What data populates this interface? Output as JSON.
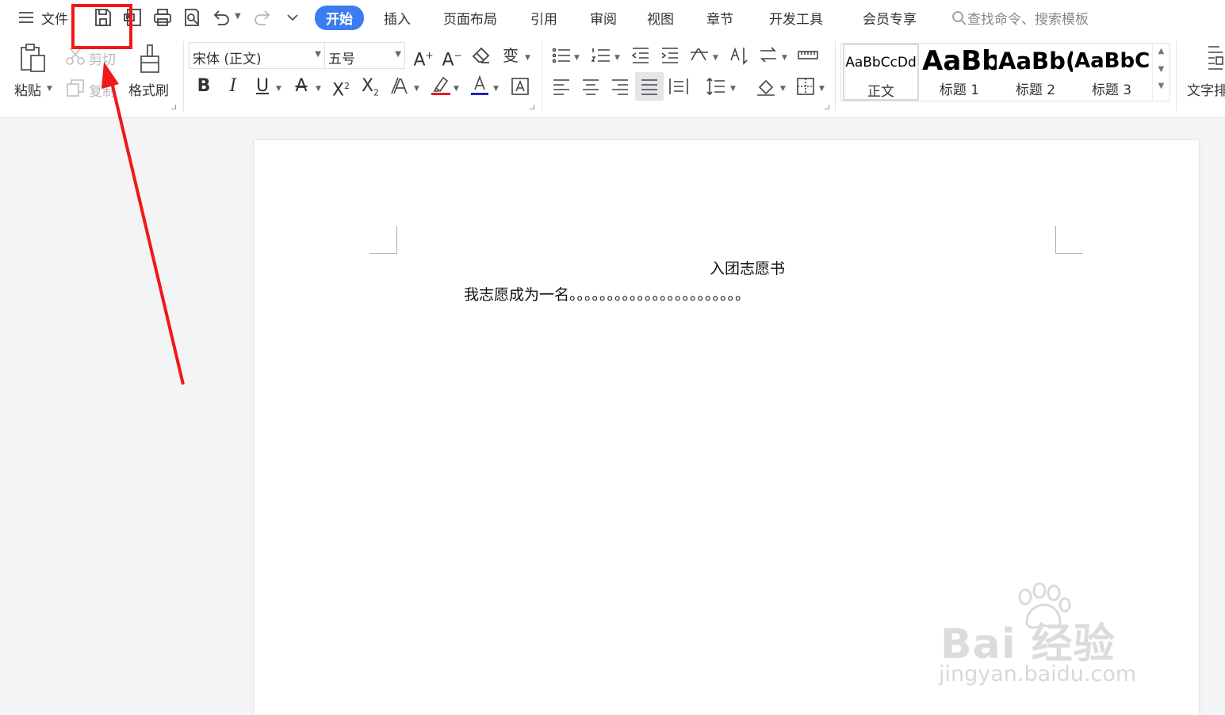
{
  "menubar": {
    "file_label": "文件",
    "tabs": [
      {
        "label": "开始",
        "active": true
      },
      {
        "label": "插入"
      },
      {
        "label": "页面布局"
      },
      {
        "label": "引用"
      },
      {
        "label": "审阅"
      },
      {
        "label": "视图"
      },
      {
        "label": "章节"
      },
      {
        "label": "开发工具"
      },
      {
        "label": "会员专享"
      }
    ],
    "search_placeholder": "查找命令、搜索模板",
    "quick_access_icons": [
      "save-icon",
      "export-pdf-icon",
      "print-icon",
      "print-preview-icon",
      "undo-icon",
      "redo-icon",
      "customize-icon"
    ]
  },
  "ribbon": {
    "clipboard": {
      "paste_label": "粘贴",
      "cut_label": "剪切",
      "copy_label": "复制",
      "format_painter_label": "格式刷"
    },
    "font": {
      "font_name": "宋体 (正文)",
      "font_size": "五号",
      "highlight_color": "#e8191e",
      "font_color": "#1f24c8"
    },
    "styles": [
      {
        "sample": "AaBbCcDd",
        "name": "正文",
        "selected": true
      },
      {
        "sample": "AaBb",
        "name": "标题 1"
      },
      {
        "sample": "AaBb(",
        "name": "标题 2"
      },
      {
        "sample": "AaBbC",
        "name": "标题 3"
      }
    ],
    "text_layout_label": "文字排"
  },
  "document": {
    "title": "入团志愿书",
    "line1": "我志愿成为一名。。。。。。。。。。。。。。。。。。。。。。。"
  },
  "watermark": {
    "brand": "Bai 经验",
    "url": "jingyan.baidu.com"
  },
  "colors": {
    "accent": "#3b7cf0",
    "annotation": "#f01818"
  }
}
